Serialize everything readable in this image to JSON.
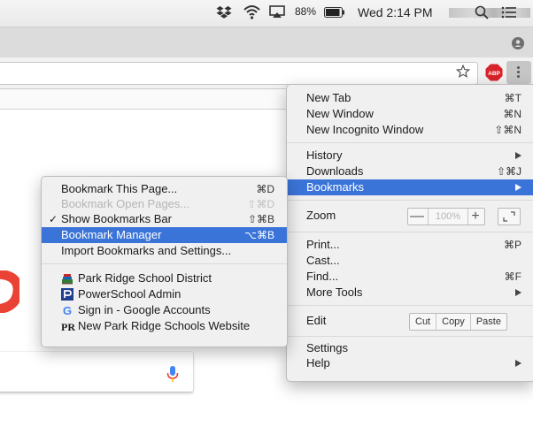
{
  "menubar": {
    "battery_pct": "88%",
    "clock": "Wed 2:14 PM",
    "icons": [
      "dropbox-icon",
      "wifi-icon",
      "airplay-icon",
      "battery-icon",
      "spotlight-search-icon",
      "notification-list-icon"
    ]
  },
  "toolbar": {
    "icons": [
      "bookmark-star-icon",
      "adblock-plus-icon",
      "chrome-menu-icon",
      "profile-icon"
    ],
    "abp_label": "ABP"
  },
  "chrome_menu": {
    "new_tab": {
      "label": "New Tab",
      "shortcut": "⌘T"
    },
    "new_window": {
      "label": "New Window",
      "shortcut": "⌘N"
    },
    "new_incognito": {
      "label": "New Incognito Window",
      "shortcut": "⇧⌘N"
    },
    "history": {
      "label": "History"
    },
    "downloads": {
      "label": "Downloads",
      "shortcut": "⇧⌘J"
    },
    "bookmarks": {
      "label": "Bookmarks"
    },
    "zoom": {
      "label": "Zoom",
      "minus": "—",
      "value": "100%",
      "plus": "+"
    },
    "print": {
      "label": "Print...",
      "shortcut": "⌘P"
    },
    "cast": {
      "label": "Cast..."
    },
    "find": {
      "label": "Find...",
      "shortcut": "⌘F"
    },
    "more_tools": {
      "label": "More Tools"
    },
    "edit": {
      "label": "Edit",
      "cut": "Cut",
      "copy": "Copy",
      "paste": "Paste"
    },
    "settings": {
      "label": "Settings"
    },
    "help": {
      "label": "Help"
    }
  },
  "bookmarks_menu": {
    "bookmark_page": {
      "label": "Bookmark This Page...",
      "shortcut": "⌘D"
    },
    "bookmark_open": {
      "label": "Bookmark Open Pages...",
      "shortcut": "⇧⌘D"
    },
    "show_bar": {
      "check": "✓",
      "label": "Show Bookmarks Bar",
      "shortcut": "⇧⌘B"
    },
    "manager": {
      "label": "Bookmark Manager",
      "shortcut": "⌥⌘B"
    },
    "import": {
      "label": "Import Bookmarks and Settings..."
    },
    "items": [
      {
        "label": "Park Ridge School District",
        "icon": "school-district-favicon"
      },
      {
        "label": "PowerSchool Admin",
        "icon": "powerschool-favicon"
      },
      {
        "label": "Sign in - Google Accounts",
        "icon": "google-favicon",
        "glyph": "G"
      },
      {
        "label": "New Park Ridge Schools Website",
        "icon": "pr-favicon",
        "glyph": "PR"
      }
    ]
  },
  "colors": {
    "highlight": "#3b74d8",
    "menu_bg": "#f0f0f0",
    "google_red": "#ea4335",
    "mic_blue": "#4285f4"
  }
}
